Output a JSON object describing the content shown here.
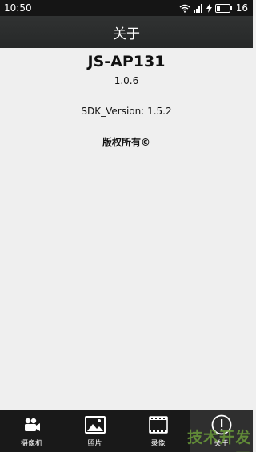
{
  "status_bar": {
    "time": "10:50",
    "battery": "16"
  },
  "title_bar": {
    "title": "关于"
  },
  "about": {
    "app_name": "JS-AP131",
    "app_version": "1.0.6",
    "sdk_version": "SDK_Version: 1.5.2",
    "copyright": "版权所有©"
  },
  "bottom_nav": {
    "items": [
      {
        "label": "摄像机",
        "icon": "camera-icon"
      },
      {
        "label": "照片",
        "icon": "photo-icon"
      },
      {
        "label": "录像",
        "icon": "film-icon"
      },
      {
        "label": "关于",
        "icon": "info-icon",
        "active": true
      }
    ]
  },
  "watermark": "技术开发网",
  "colors": {
    "background": "#efefef",
    "title_bar": "#2c2e2e",
    "nav_bar": "#191919",
    "watermark": "#6a9a3a"
  }
}
